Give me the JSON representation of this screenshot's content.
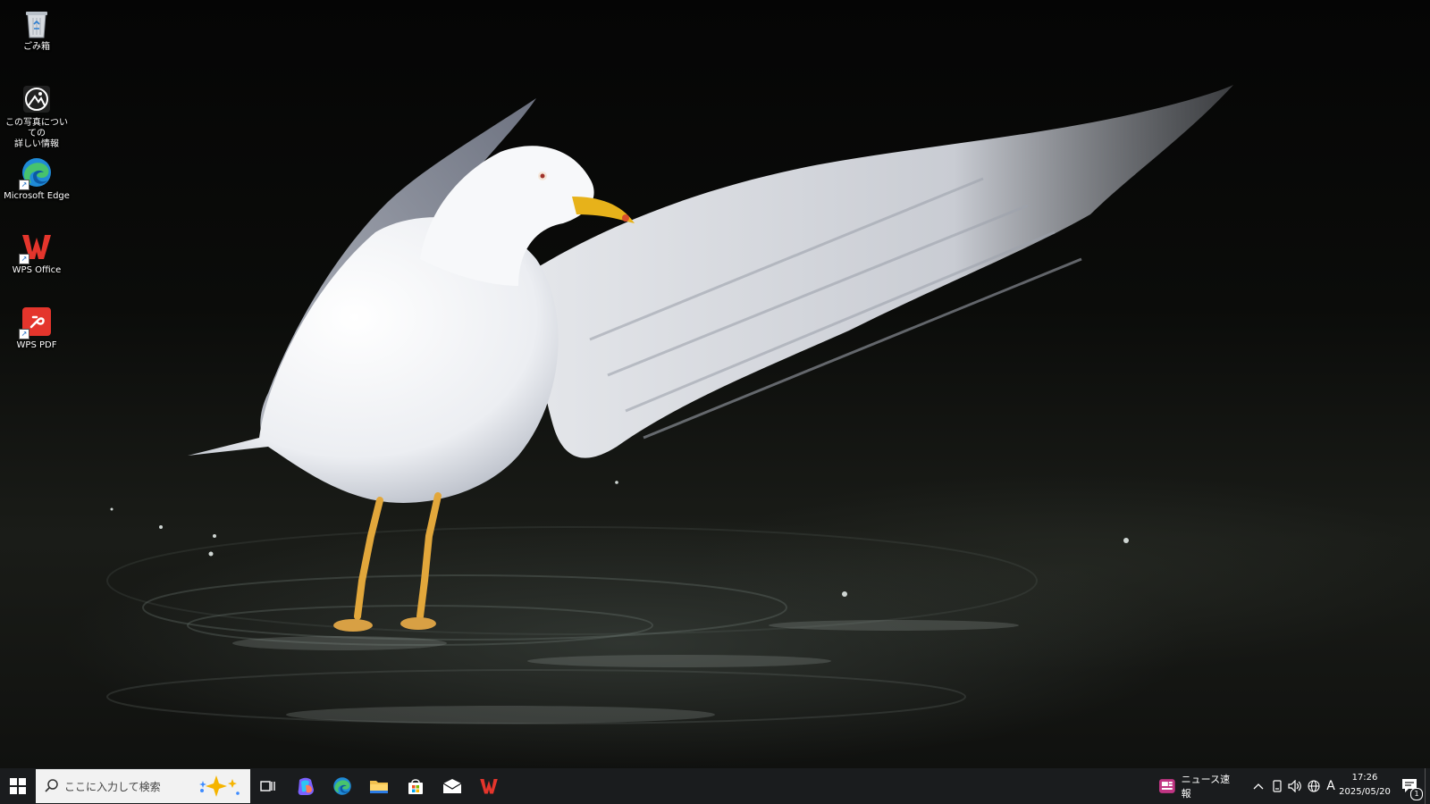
{
  "desktop": {
    "icons": [
      {
        "label": "ごみ箱",
        "icon": "recycle-bin-icon"
      },
      {
        "label_line1": "この写真についての",
        "label_line2": "詳しい情報",
        "icon": "photo-info-icon"
      },
      {
        "label": "Microsoft Edge",
        "icon": "edge-icon"
      },
      {
        "label": "WPS Office",
        "icon": "wps-office-icon"
      },
      {
        "label": "WPS PDF",
        "icon": "wps-pdf-icon"
      }
    ]
  },
  "taskbar": {
    "search_placeholder": "ここに入力して検索",
    "pinned_apps": [
      "task-view-icon",
      "copilot-icon",
      "edge-icon",
      "file-explorer-icon",
      "microsoft-store-icon",
      "mail-icon",
      "wps-office-icon"
    ],
    "news_label": "ニュース速報",
    "ime_mode": "A",
    "time": "17:26",
    "date": "2025/05/20",
    "notification_count": "1"
  },
  "colors": {
    "taskbar_bg": "#1a1c1e",
    "search_bg": "#f2f2f2",
    "wps_red": "#e4352c",
    "edge_blue": "#1f8ad6",
    "edge_green": "#47c36d"
  }
}
